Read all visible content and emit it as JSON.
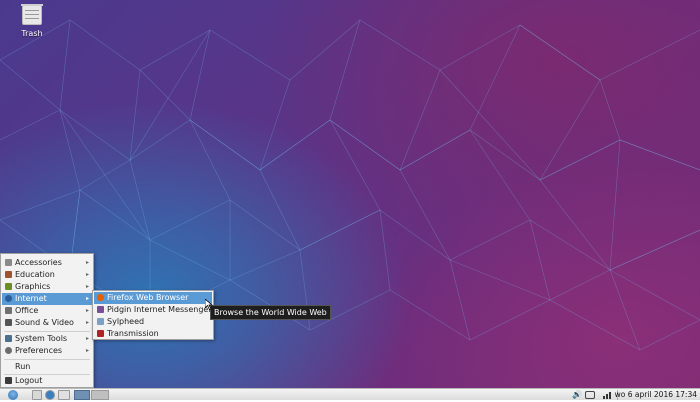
{
  "desktop": {
    "icons": [
      {
        "label": "Trash",
        "icon": "trash-icon"
      }
    ]
  },
  "main_menu": {
    "items": [
      {
        "label": "Accessories",
        "icon": "accessories-icon",
        "submenu": true
      },
      {
        "label": "Education",
        "icon": "education-icon",
        "submenu": true
      },
      {
        "label": "Graphics",
        "icon": "graphics-icon",
        "submenu": true
      },
      {
        "label": "Internet",
        "icon": "internet-icon",
        "submenu": true,
        "active": true
      },
      {
        "label": "Office",
        "icon": "office-icon",
        "submenu": true
      },
      {
        "label": "Sound & Video",
        "icon": "sound-video-icon",
        "submenu": true
      },
      {
        "label": "System Tools",
        "icon": "system-tools-icon",
        "submenu": true
      },
      {
        "label": "Preferences",
        "icon": "preferences-icon",
        "submenu": true
      },
      {
        "label": "Run",
        "icon": "",
        "submenu": false
      },
      {
        "label": "Logout",
        "icon": "logout-icon",
        "submenu": false
      }
    ]
  },
  "internet_menu": {
    "items": [
      {
        "label": "Firefox Web Browser",
        "icon": "firefox-icon",
        "active": true
      },
      {
        "label": "Pidgin Internet Messenger",
        "icon": "pidgin-icon"
      },
      {
        "label": "Sylpheed",
        "icon": "sylpheed-icon"
      },
      {
        "label": "Transmission",
        "icon": "transmission-icon"
      }
    ]
  },
  "tooltip": {
    "text": "Browse the World Wide Web"
  },
  "panel": {
    "clock": "wo  6 april 2016  17:34",
    "tray_icons": [
      "volume-icon",
      "keyboard-icon",
      "network-icon"
    ]
  },
  "colors": {
    "menu_highlight": "#5b9bd5",
    "desktop_purple": "#6e2d7c",
    "desktop_blue": "#2f74b4"
  }
}
